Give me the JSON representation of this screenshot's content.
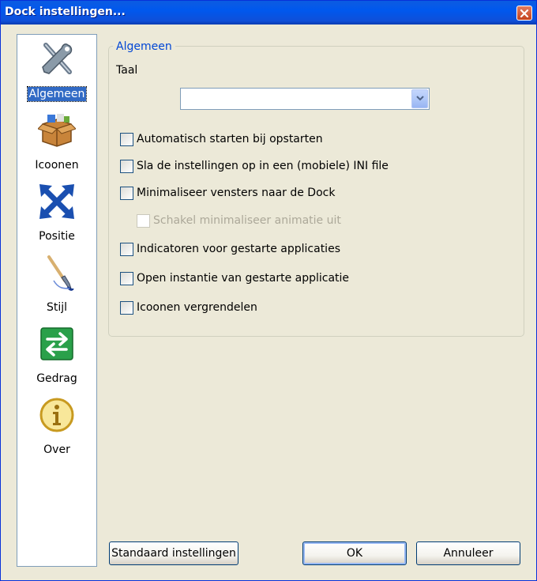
{
  "window": {
    "title": "Dock instellingen..."
  },
  "sidebar": {
    "items": [
      {
        "label": "Algemeen",
        "icon": "tools-icon",
        "selected": true
      },
      {
        "label": "Icoonen",
        "icon": "box-icon",
        "selected": false
      },
      {
        "label": "Positie",
        "icon": "move-arrows-icon",
        "selected": false
      },
      {
        "label": "Stijl",
        "icon": "paintbrush-icon",
        "selected": false
      },
      {
        "label": "Gedrag",
        "icon": "swap-arrows-icon",
        "selected": false
      },
      {
        "label": "Over",
        "icon": "info-icon",
        "selected": false
      }
    ]
  },
  "general": {
    "group_title": "Algemeen",
    "language_label": "Taal",
    "language_value": "",
    "options": [
      {
        "label": "Automatisch starten bij opstarten",
        "checked": false,
        "enabled": true
      },
      {
        "label": "Sla de instellingen op in een (mobiele) INI file",
        "checked": false,
        "enabled": true
      },
      {
        "label": "Minimaliseer vensters naar de Dock",
        "checked": false,
        "enabled": true
      },
      {
        "label": "Schakel minimaliseer animatie uit",
        "checked": false,
        "enabled": false
      },
      {
        "label": "Indicatoren voor gestarte applicaties",
        "checked": false,
        "enabled": true
      },
      {
        "label": "Open instantie van gestarte applicatie",
        "checked": false,
        "enabled": true
      },
      {
        "label": "Icoonen vergrendelen",
        "checked": false,
        "enabled": true
      }
    ]
  },
  "buttons": {
    "defaults_label": "Standaard instellingen",
    "ok_label": "OK",
    "cancel_label": "Annuleer"
  },
  "colors": {
    "titlebar": "#0058ee",
    "selection": "#316ac5",
    "group_title": "#0046d5"
  }
}
